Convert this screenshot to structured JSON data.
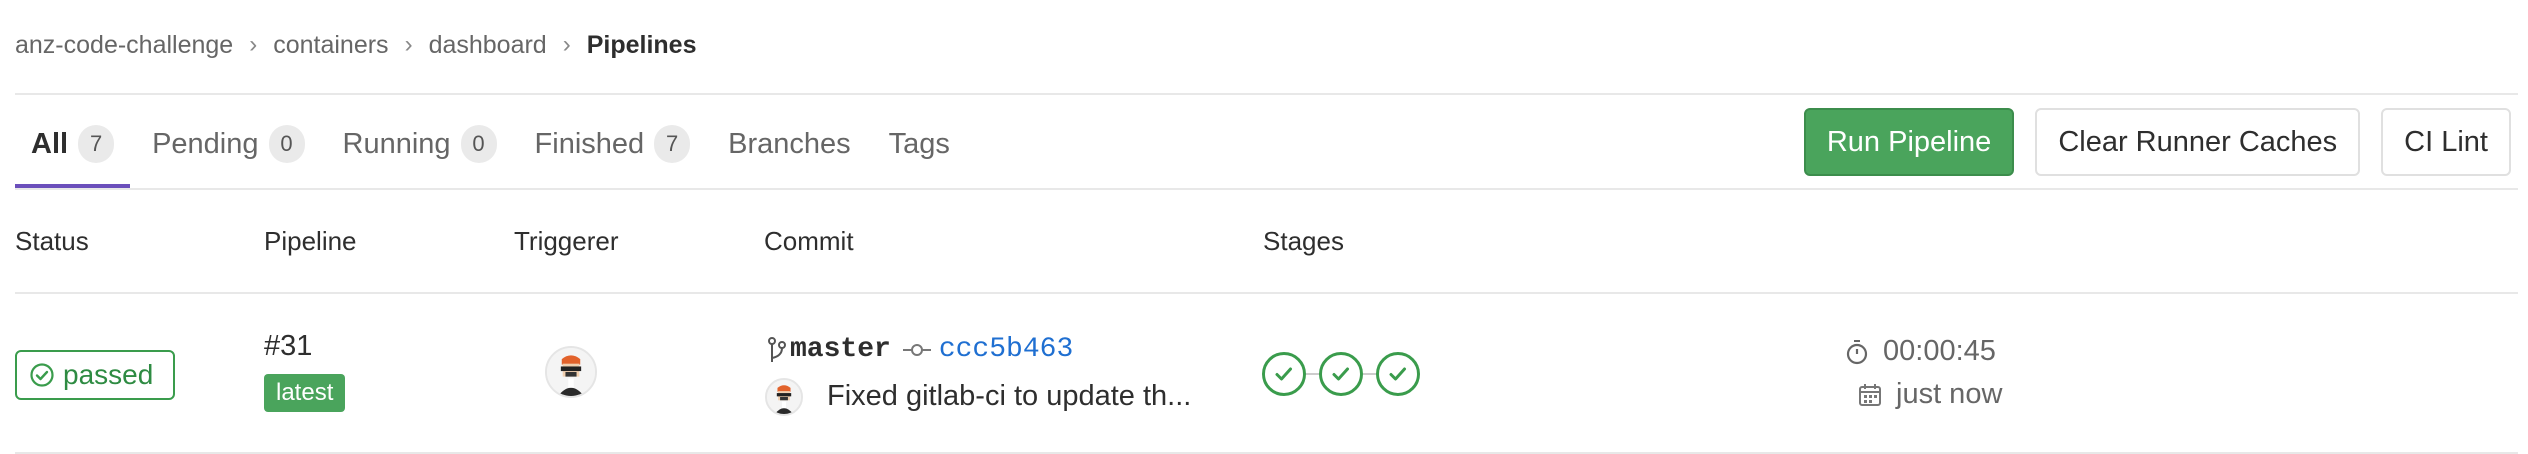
{
  "breadcrumb": {
    "items": [
      "anz-code-challenge",
      "containers",
      "dashboard"
    ],
    "current": "Pipelines",
    "separator": "›"
  },
  "tabs": [
    {
      "label": "All",
      "count": "7",
      "active": true
    },
    {
      "label": "Pending",
      "count": "0"
    },
    {
      "label": "Running",
      "count": "0"
    },
    {
      "label": "Finished",
      "count": "7"
    },
    {
      "label": "Branches"
    },
    {
      "label": "Tags"
    }
  ],
  "actions": {
    "run_pipeline": "Run Pipeline",
    "clear_caches": "Clear Runner Caches",
    "ci_lint": "CI Lint"
  },
  "table": {
    "headers": {
      "status": "Status",
      "pipeline": "Pipeline",
      "triggerer": "Triggerer",
      "commit": "Commit",
      "stages": "Stages"
    },
    "row": {
      "status": "passed",
      "pipeline_id": "#31",
      "pipeline_tag": "latest",
      "branch": "master",
      "sha": "ccc5b463",
      "message": "Fixed gitlab-ci to update th...",
      "stages": [
        "passed",
        "passed",
        "passed"
      ],
      "duration": "00:00:45",
      "finished": "just now"
    }
  },
  "colors": {
    "success": "#3a9c4c",
    "primary_button": "#4aa45c",
    "active_tab": "#6b4fbb",
    "link": "#1f6fd1"
  },
  "icons": {
    "status": "check-circle-icon",
    "branch": "git-branch-icon",
    "commit": "commit-icon",
    "duration": "timer-icon",
    "finished": "calendar-icon"
  }
}
